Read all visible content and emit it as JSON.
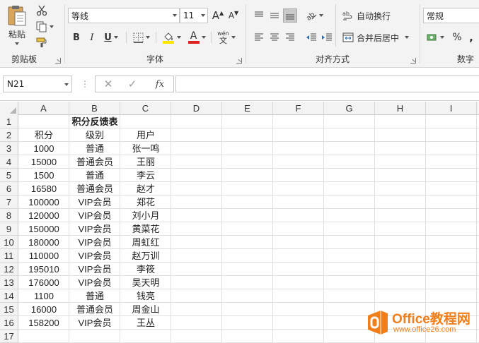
{
  "ribbon": {
    "clipboard": {
      "label": "剪贴板",
      "paste_label": "粘贴"
    },
    "font": {
      "label": "字体",
      "font_name": "等线",
      "font_size": "11",
      "bold": "B",
      "italic": "I",
      "underline": "U",
      "font_color_glyph": "A",
      "grow_glyph": "A",
      "shrink_glyph": "A",
      "phonetic_top": "wén",
      "phonetic_bottom": "文"
    },
    "alignment": {
      "label": "对齐方式",
      "wrap_text": "自动换行",
      "merge_center": "合并后居中"
    },
    "number": {
      "label": "数字",
      "format": "常规",
      "percent": "%",
      "comma": ","
    }
  },
  "formula_bar": {
    "name_box": "N21",
    "fx": "fx",
    "formula": ""
  },
  "grid": {
    "columns": [
      "A",
      "B",
      "C",
      "D",
      "E",
      "F",
      "G",
      "H",
      "I"
    ],
    "rows": [
      "1",
      "2",
      "3",
      "4",
      "5",
      "6",
      "7",
      "8",
      "9",
      "10",
      "11",
      "12",
      "13",
      "14",
      "15",
      "16",
      "17"
    ],
    "title": "积分反馈表",
    "headers": [
      "积分",
      "级别",
      "用户"
    ],
    "data": [
      [
        "1000",
        "普通",
        "张一鸣"
      ],
      [
        "15000",
        "普通会员",
        "王丽"
      ],
      [
        "1500",
        "普通",
        "李云"
      ],
      [
        "16580",
        "普通会员",
        "赵才"
      ],
      [
        "100000",
        "VIP会员",
        "郑花"
      ],
      [
        "120000",
        "VIP会员",
        "刘小月"
      ],
      [
        "150000",
        "VIP会员",
        "黄菜花"
      ],
      [
        "180000",
        "VIP会员",
        "周虹红"
      ],
      [
        "110000",
        "VIP会员",
        "赵万训"
      ],
      [
        "195010",
        "VIP会员",
        "李筱"
      ],
      [
        "176000",
        "VIP会员",
        "吴天明"
      ],
      [
        "1100",
        "普通",
        "钱亮"
      ],
      [
        "16000",
        "普通会员",
        "周金山"
      ],
      [
        "158200",
        "VIP会员",
        "王丛"
      ]
    ]
  },
  "watermark": {
    "brand": "Office教程网",
    "url": "www.office26.com"
  },
  "colors": {
    "font_color": "#e02020",
    "highlight": "#ffe600",
    "watermark_orange": "#f07e1b"
  }
}
